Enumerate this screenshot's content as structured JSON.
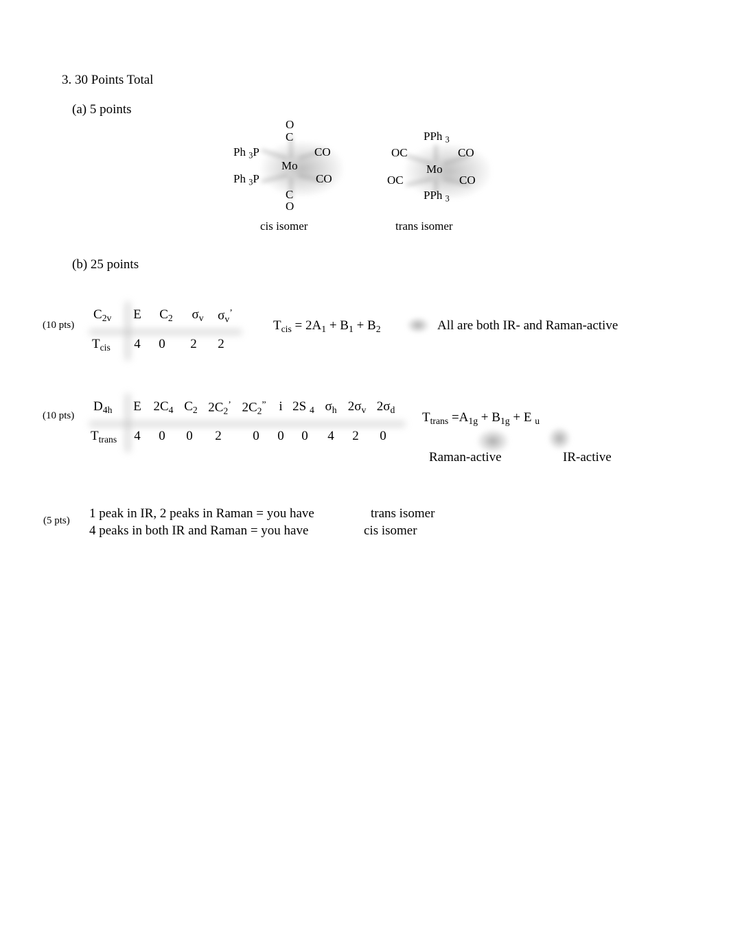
{
  "document": {
    "question_title": "3. 30 Points Total",
    "part_a_label": "(a) 5 points",
    "part_b_label": "(b) 25 points"
  },
  "structures": {
    "cis": {
      "center": "Mo",
      "top_outer": "O",
      "top_inner": "C",
      "bottom_inner": "C",
      "bottom_outer": "O",
      "upper_left": "Ph 3P",
      "lower_left": "Ph 3P",
      "upper_right": "CO",
      "lower_right": "CO",
      "caption": "cis  isomer"
    },
    "trans": {
      "center": "Mo",
      "top": "PPh 3",
      "bottom": "PPh 3",
      "upper_left": "OC",
      "lower_left": "OC",
      "upper_right": "CO",
      "lower_right": "CO",
      "caption": "trans   isomer"
    }
  },
  "cis_table": {
    "points_label": "(10 pts)",
    "group": "C2v",
    "operations": [
      "E",
      "C2",
      "σv",
      "σv’"
    ],
    "row_label": "Tcis",
    "characters": [
      "4",
      "0",
      "2",
      "2"
    ],
    "reduction": "Tcis = 2A1 + B1 + B2",
    "activity_note": "All are both IR- and Raman-active"
  },
  "trans_table": {
    "points_label": "(10 pts)",
    "group": "D4h",
    "operations": [
      "E",
      "2C4",
      "C2",
      "2C2’",
      "2C2”",
      "i",
      "2S 4",
      "σh",
      "2σv",
      "2σd"
    ],
    "row_label": "Ttrans",
    "characters": [
      "4",
      "0",
      "0",
      "2",
      "0",
      "0",
      "0",
      "4",
      "2",
      "0"
    ],
    "reduction": "Ttrans  =A1g + B1g + E u",
    "raman_label": "Raman-active",
    "ir_label": "IR-active"
  },
  "conclusion": {
    "points_label": "(5 pts)",
    "line1_text": "1 peak in IR, 2 peaks in Raman = you have",
    "line1_answer": "trans   isomer",
    "line2_text": "4 peaks in both IR and Raman = you have",
    "line2_answer": "cis  isomer"
  }
}
